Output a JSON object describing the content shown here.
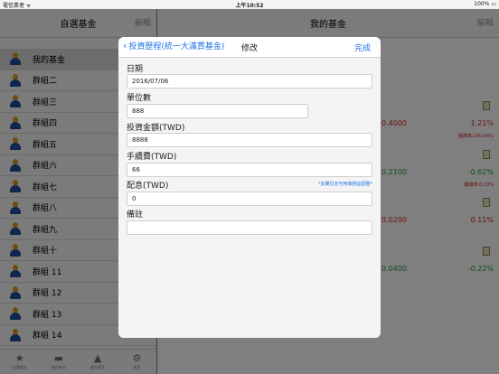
{
  "status": {
    "carrier": "電信業者 ᯤ",
    "time": "上午10:52",
    "battery": "100% ▭"
  },
  "left": {
    "title": "自選基金",
    "edit_label": "編輯",
    "groups": [
      {
        "label": "我的基金"
      },
      {
        "label": "群組二"
      },
      {
        "label": "群組三"
      },
      {
        "label": "群組四"
      },
      {
        "label": "群組五"
      },
      {
        "label": "群組六"
      },
      {
        "label": "群組七"
      },
      {
        "label": "群組八"
      },
      {
        "label": "群組九"
      },
      {
        "label": "群組十"
      },
      {
        "label": "群組 11"
      },
      {
        "label": "群組 12"
      },
      {
        "label": "群組 13"
      },
      {
        "label": "群組 14"
      }
    ],
    "tabs": [
      {
        "icon": "★",
        "label": "自選基金"
      },
      {
        "icon": "▬",
        "label": "國內基金"
      },
      {
        "icon": "▲",
        "label": "國外基金"
      },
      {
        "icon": "⚙",
        "label": "更多"
      }
    ]
  },
  "right": {
    "title": "我的基金",
    "edit_label": "編輯",
    "funds": [
      {
        "nav": "0.4000",
        "pct": "1.21%",
        "rate": "報酬率:230.64%",
        "color": "#d22"
      },
      {
        "nav": "0.2100",
        "pct": "-0.62%",
        "rate": "報酬率:0.33%",
        "color": "#1c9a3c",
        "rate_color": "#d22"
      },
      {
        "nav": "0.0200",
        "pct": "0.11%",
        "rate": "",
        "color": "#d22"
      },
      {
        "nav": "0.0400",
        "pct": "-0.22%",
        "rate": "",
        "color": "#1c9a3c"
      }
    ]
  },
  "modal": {
    "back_label": "投資歷程(統一大滿貫基金)",
    "title": "修改",
    "done_label": "完成",
    "fields": {
      "date": {
        "label": "日期",
        "value": "2016/07/06"
      },
      "units": {
        "label": "單位數",
        "value": "888"
      },
      "amount": {
        "label": "投資金額(TWD)",
        "value": "8888"
      },
      "fee": {
        "label": "手續費(TWD)",
        "value": "66"
      },
      "dividend": {
        "label": "配息(TWD)",
        "value": "0",
        "hint": "*此欄位亦可用做損益調整*"
      },
      "note": {
        "label": "備註",
        "value": ""
      }
    }
  }
}
